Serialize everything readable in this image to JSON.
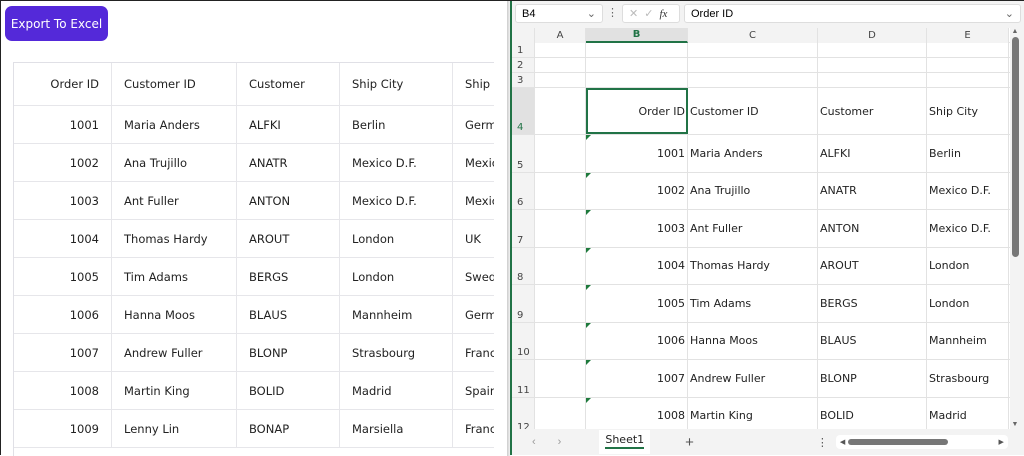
{
  "left": {
    "export_label": "Export To Excel",
    "columns": [
      "Order ID",
      "Customer ID",
      "Customer",
      "Ship City",
      "Ship Country"
    ],
    "rows": [
      [
        "1001",
        "Maria Anders",
        "ALFKI",
        "Berlin",
        "Germany"
      ],
      [
        "1002",
        "Ana Trujillo",
        "ANATR",
        "Mexico D.F.",
        "Mexico"
      ],
      [
        "1003",
        "Ant Fuller",
        "ANTON",
        "Mexico D.F.",
        "Mexico"
      ],
      [
        "1004",
        "Thomas Hardy",
        "AROUT",
        "London",
        "UK"
      ],
      [
        "1005",
        "Tim Adams",
        "BERGS",
        "London",
        "Sweden"
      ],
      [
        "1006",
        "Hanna Moos",
        "BLAUS",
        "Mannheim",
        "Germany"
      ],
      [
        "1007",
        "Andrew Fuller",
        "BLONP",
        "Strasbourg",
        "France"
      ],
      [
        "1008",
        "Martin King",
        "BOLID",
        "Madrid",
        "Spain"
      ],
      [
        "1009",
        "Lenny Lin",
        "BONAP",
        "Marsiella",
        "France"
      ]
    ]
  },
  "excel": {
    "name_box": "B4",
    "formula": "Order ID",
    "fx": "fx",
    "col_headers": [
      "A",
      "B",
      "C",
      "D",
      "E"
    ],
    "row_numbers": [
      "1",
      "2",
      "3",
      "4",
      "5",
      "6",
      "7",
      "8",
      "9",
      "10",
      "11",
      "12"
    ],
    "sheet_tab": "Sheet1",
    "accent": "#217346"
  }
}
